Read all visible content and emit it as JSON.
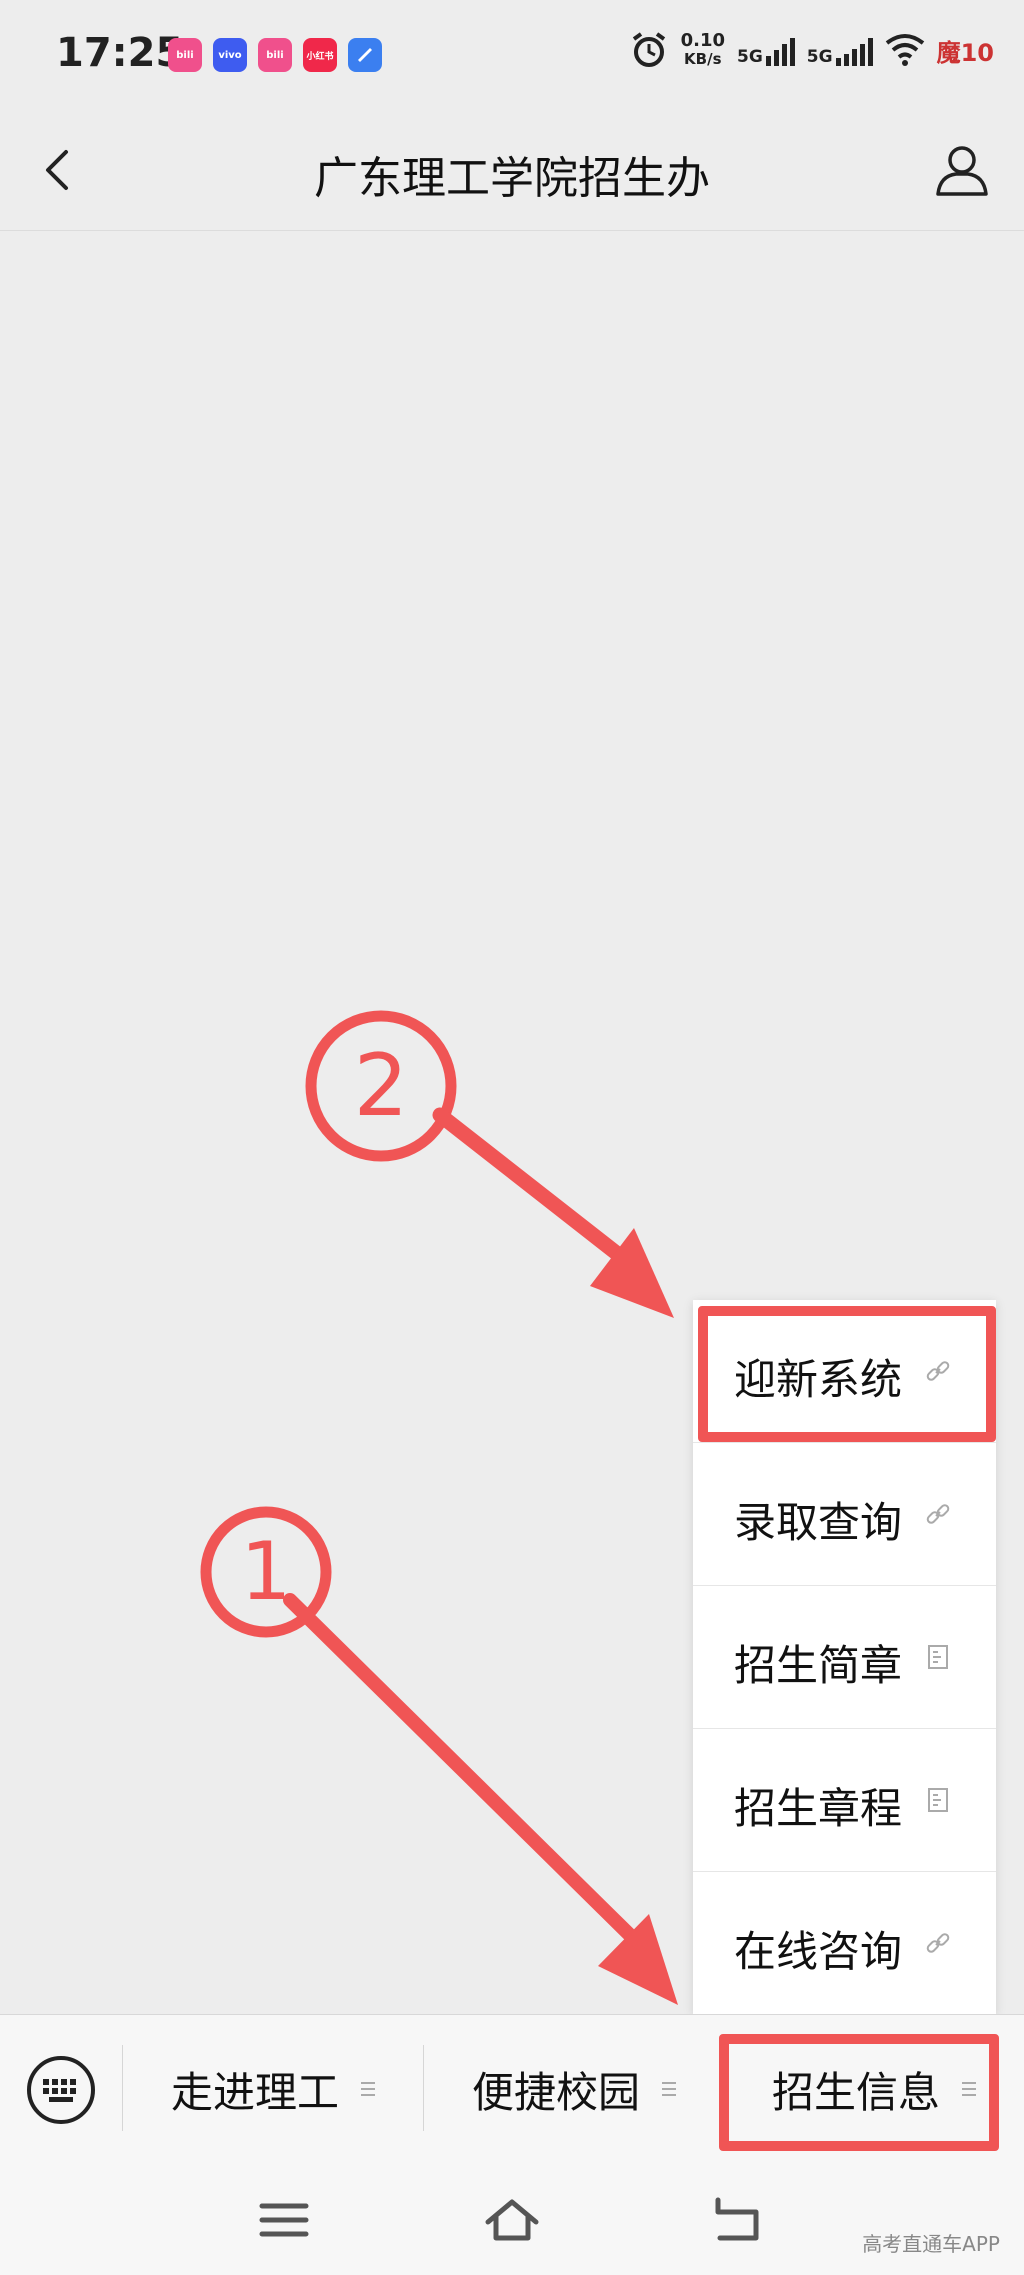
{
  "status_bar": {
    "time": "17:25",
    "apps": [
      {
        "name": "bilibili-icon",
        "color": "#f0508c",
        "text": "bili"
      },
      {
        "name": "vivo-icon",
        "color": "#3e5cf0",
        "text": "vivo"
      },
      {
        "name": "bilibili-icon-2",
        "color": "#f0508c",
        "text": "bili"
      },
      {
        "name": "xiaohongshu-icon",
        "color": "#f0284a",
        "text": "小红书"
      },
      {
        "name": "app-icon",
        "color": "#3b7ff0",
        "text": ""
      }
    ],
    "speed_top": "0.10",
    "speed_bottom": "KB/s",
    "net1": "5G",
    "net2": "5G",
    "battery": "魔10"
  },
  "navbar": {
    "title": "广东理工学院招生办"
  },
  "popup_menu": {
    "items": [
      {
        "label": "迎新系统",
        "icon": "link-icon"
      },
      {
        "label": "录取查询",
        "icon": "link-icon"
      },
      {
        "label": "招生简章",
        "icon": "doc-icon"
      },
      {
        "label": "招生章程",
        "icon": "doc-icon"
      },
      {
        "label": "在线咨询",
        "icon": "link-icon"
      }
    ]
  },
  "menu_bar": {
    "items": [
      {
        "label": "走进理工"
      },
      {
        "label": "便捷校园"
      },
      {
        "label": "招生信息"
      }
    ]
  },
  "annotations": {
    "step1": "1",
    "step2": "2",
    "color": "#f05555"
  },
  "watermark": "高考直通车APP"
}
